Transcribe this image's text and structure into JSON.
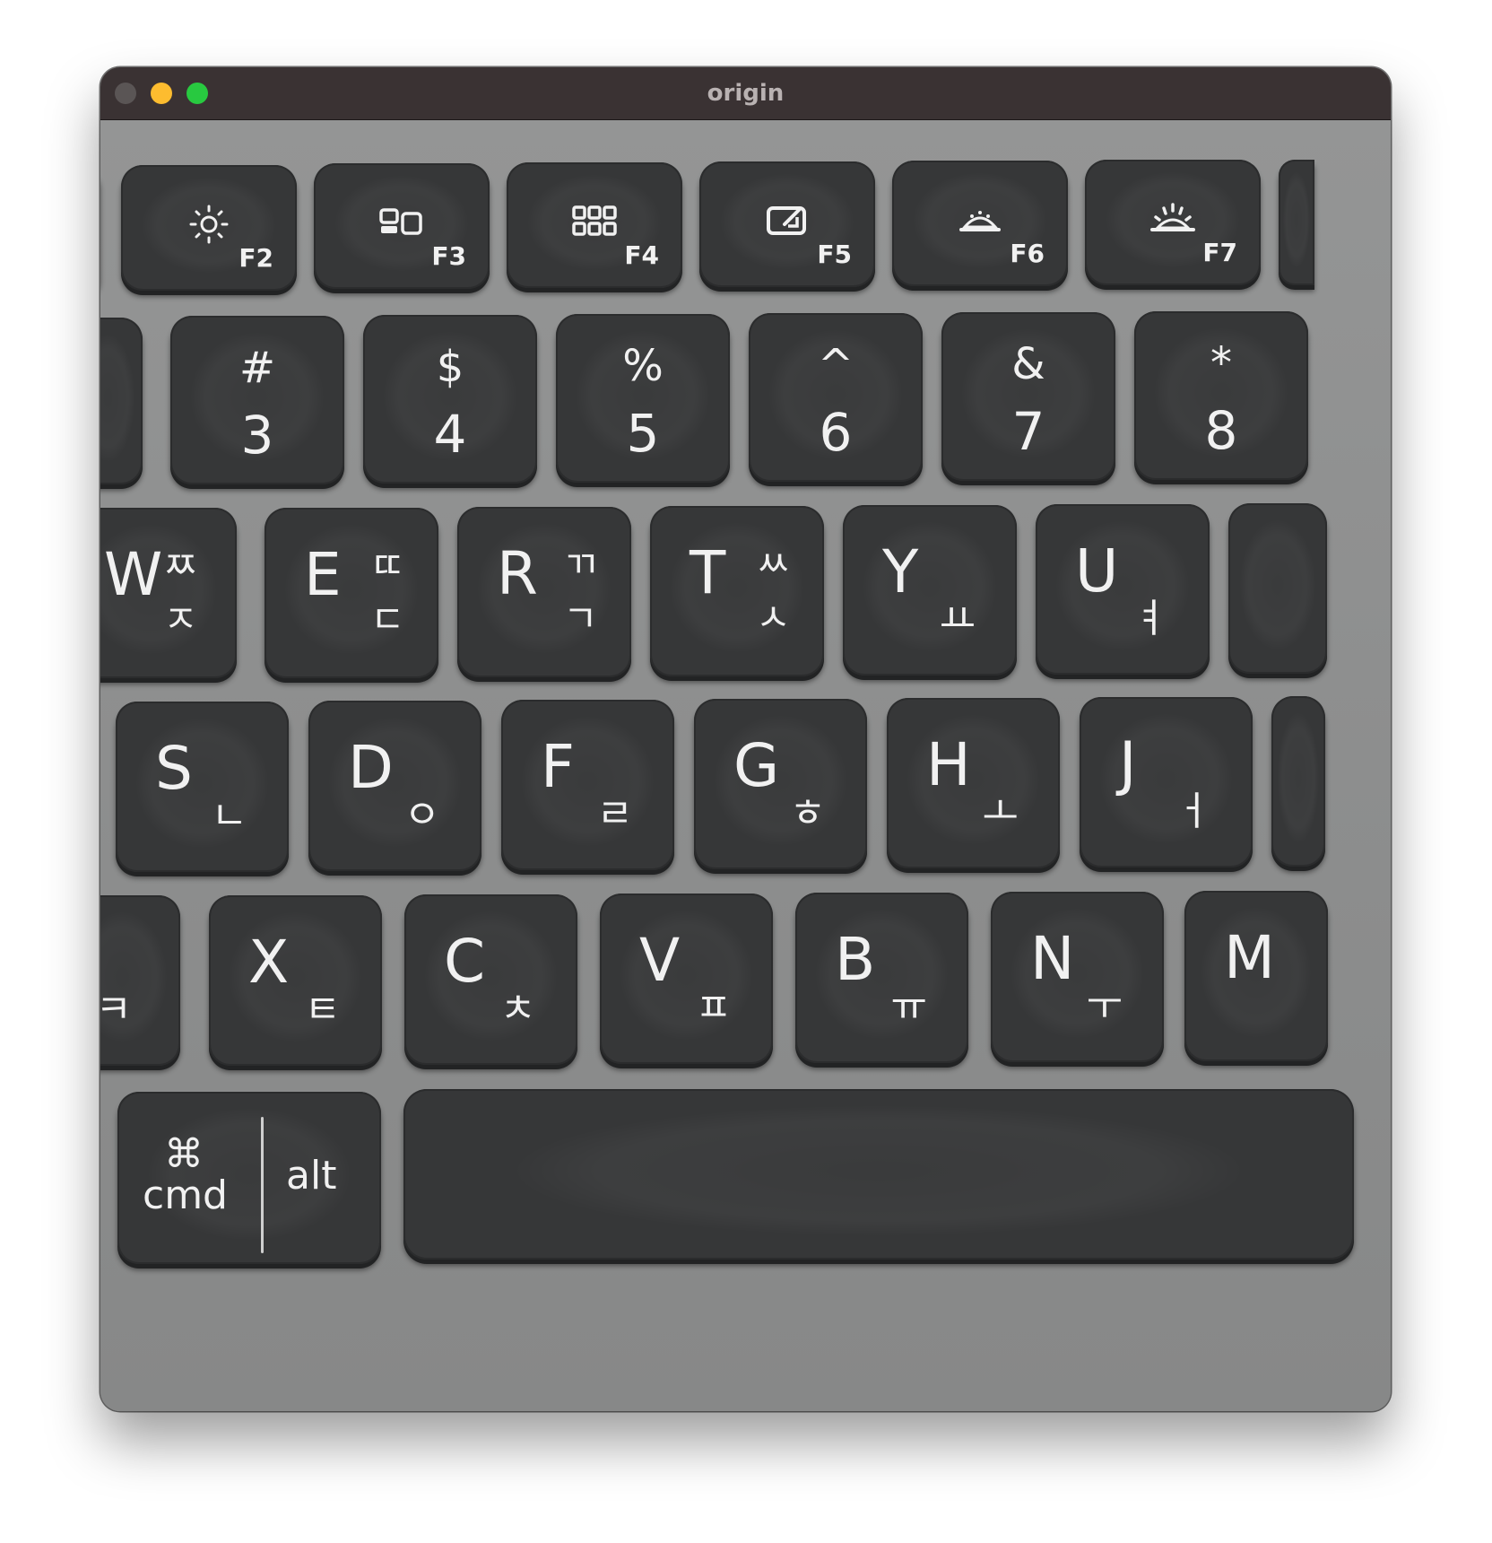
{
  "window": {
    "title": "origin"
  },
  "photo": {
    "function_row": [
      {
        "fn": "F2",
        "icon": "brightness-icon"
      },
      {
        "fn": "F3",
        "icon": "app-switch-icon"
      },
      {
        "fn": "F4",
        "icon": "launchpad-icon"
      },
      {
        "fn": "F5",
        "icon": "screenshot-icon"
      },
      {
        "fn": "F6",
        "icon": "backlight-down-icon"
      },
      {
        "fn": "F7",
        "icon": "backlight-up-icon"
      }
    ],
    "number_row": [
      {
        "top": "#",
        "bottom": "3"
      },
      {
        "top": "$",
        "bottom": "4"
      },
      {
        "top": "%",
        "bottom": "5"
      },
      {
        "top": "^",
        "bottom": "6"
      },
      {
        "top": "&",
        "bottom": "7"
      },
      {
        "top": "*",
        "bottom": "8"
      }
    ],
    "qwerty_row": [
      {
        "letter": "W",
        "hangul_top": "ㅉ",
        "hangul_bottom": "ㅈ"
      },
      {
        "letter": "E",
        "hangul_top": "ㄸ",
        "hangul_bottom": "ㄷ"
      },
      {
        "letter": "R",
        "hangul_top": "ㄲ",
        "hangul_bottom": "ㄱ"
      },
      {
        "letter": "T",
        "hangul_top": "ㅆ",
        "hangul_bottom": "ㅅ"
      },
      {
        "letter": "Y",
        "hangul": "ㅛ"
      },
      {
        "letter": "U",
        "hangul": "ㅕ"
      }
    ],
    "home_row": [
      {
        "letter": "S",
        "hangul": "ㄴ"
      },
      {
        "letter": "D",
        "hangul": "ㅇ"
      },
      {
        "letter": "F",
        "hangul": "ㄹ"
      },
      {
        "letter": "G",
        "hangul": "ㅎ"
      },
      {
        "letter": "H",
        "hangul": "ㅗ"
      },
      {
        "letter": "J",
        "hangul": "ㅓ"
      }
    ],
    "bottom_row": [
      {
        "letter": "",
        "hangul": "ㅋ"
      },
      {
        "letter": "X",
        "hangul": "ㅌ"
      },
      {
        "letter": "C",
        "hangul": "ㅊ"
      },
      {
        "letter": "V",
        "hangul": "ㅍ"
      },
      {
        "letter": "B",
        "hangul": "ㅠ"
      },
      {
        "letter": "N",
        "hangul": "ㅜ"
      },
      {
        "letter": "M",
        "hangul": ""
      }
    ],
    "modifier_row": {
      "cmd_symbol": "⌘",
      "cmd_label": "cmd",
      "alt_label": "alt"
    }
  }
}
